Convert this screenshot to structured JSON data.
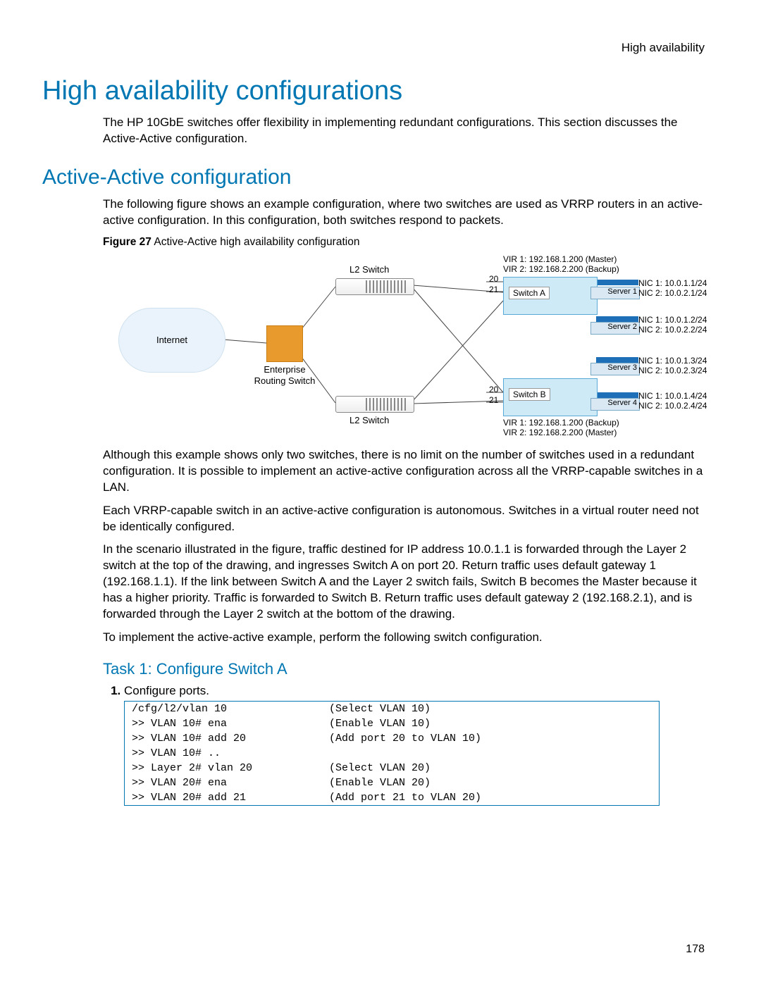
{
  "running_header": "High availability",
  "h1": "High availability configurations",
  "intro": "The HP 10GbE switches offer flexibility in implementing redundant configurations. This section discusses the Active-Active configuration.",
  "h2": "Active-Active configuration",
  "p2": "The following figure shows an example configuration, where two switches are used as VRRP routers in an active-active configuration. In this configuration, both switches respond to packets.",
  "figure": {
    "label": "Figure 27",
    "caption": "Active-Active high availability configuration"
  },
  "diagram": {
    "internet": "Internet",
    "router1": "Enterprise",
    "router2": "Routing Switch",
    "l2top": "L2 Switch",
    "l2bot": "L2 Switch",
    "port20": "20",
    "port21": "21",
    "switchA": "Switch A",
    "switchB": "Switch B",
    "virA1": "VIR 1: 192.168.1.200 (Master)",
    "virA2": "VIR 2: 192.168.2.200 (Backup)",
    "virB1": "VIR 1: 192.168.1.200 (Backup)",
    "virB2": "VIR 2: 192.168.2.200 (Master)",
    "servers": {
      "s1": "Server 1",
      "s2": "Server 2",
      "s3": "Server 3",
      "s4": "Server 4"
    },
    "nic": {
      "s1a": "NIC 1: 10.0.1.1/24",
      "s1b": "NIC 2: 10.0.2.1/24",
      "s2a": "NIC 1: 10.0.1.2/24",
      "s2b": "NIC 2: 10.0.2.2/24",
      "s3a": "NIC 1: 10.0.1.3/24",
      "s3b": "NIC 2: 10.0.2.3/24",
      "s4a": "NIC 1: 10.0.1.4/24",
      "s4b": "NIC 2: 10.0.2.4/24"
    }
  },
  "p3": "Although this example shows only two switches, there is no limit on the number of switches used in a redundant configuration. It is possible to implement an active-active configuration across all the VRRP-capable switches in a LAN.",
  "p4": "Each VRRP-capable switch in an active-active configuration is autonomous. Switches in a virtual router need not be identically configured.",
  "p5": "In the scenario illustrated in the figure, traffic destined for IP address 10.0.1.1 is forwarded through the Layer 2 switch at the top of the drawing, and ingresses Switch A on port 20. Return traffic uses default gateway 1 (192.168.1.1). If the link between Switch A and the Layer 2 switch fails, Switch B becomes the Master because it has a higher priority. Traffic is forwarded to Switch B. Return traffic uses default gateway 2 (192.168.2.1), and is forwarded through the Layer 2 switch at the bottom of the drawing.",
  "p6": "To implement the active-active example, perform the following switch configuration.",
  "h3": "Task 1: Configure Switch A",
  "step1": "Configure ports.",
  "code": [
    {
      "cmd": "/cfg/l2/vlan 10",
      "desc": "(Select VLAN 10)"
    },
    {
      "cmd": ">> VLAN 10# ena",
      "desc": "(Enable VLAN 10)"
    },
    {
      "cmd": ">> VLAN 10# add 20",
      "desc": "(Add port 20 to VLAN 10)"
    },
    {
      "cmd": ">> VLAN 10# ..",
      "desc": ""
    },
    {
      "cmd": ">> Layer 2# vlan 20",
      "desc": "(Select VLAN 20)"
    },
    {
      "cmd": ">> VLAN 20# ena",
      "desc": "(Enable VLAN 20)"
    },
    {
      "cmd": ">> VLAN 20# add 21",
      "desc": "(Add port 21 to VLAN 20)"
    }
  ],
  "page_number": "178"
}
